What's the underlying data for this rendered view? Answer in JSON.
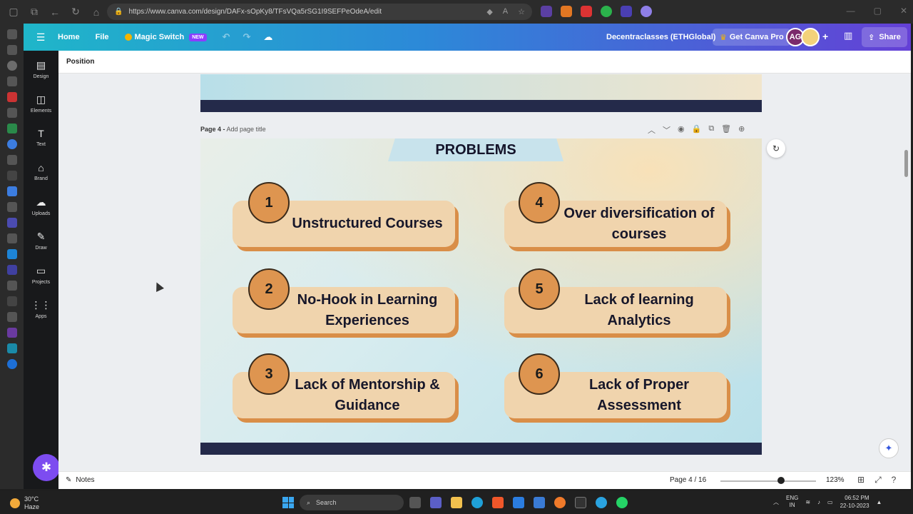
{
  "browser": {
    "url": "https://www.canva.com/design/DAFx-sOpKy8/TFsVQa5rSG1I9SEFPeOdeA/edit"
  },
  "canva": {
    "menu": {
      "home": "Home",
      "file": "File",
      "magic_switch": "Magic Switch",
      "new_badge": "NEW"
    },
    "doc_title": "Decentraclasses (ETHGlobal)",
    "get_pro": "Get Canva Pro",
    "avatar_initials": "AG",
    "share": "Share"
  },
  "rail": [
    {
      "label": "Design",
      "icon": "▤"
    },
    {
      "label": "Elements",
      "icon": "◫"
    },
    {
      "label": "Text",
      "icon": "T"
    },
    {
      "label": "Brand",
      "icon": "⌂"
    },
    {
      "label": "Uploads",
      "icon": "☁"
    },
    {
      "label": "Draw",
      "icon": "✎"
    },
    {
      "label": "Projects",
      "icon": "▭"
    },
    {
      "label": "Apps",
      "icon": "⋮⋮"
    }
  ],
  "toolbar": {
    "position": "Position"
  },
  "page": {
    "label": "Page 4 -",
    "title_placeholder": "Add page title"
  },
  "slide": {
    "title": "PROBLEMS",
    "items": [
      {
        "num": "1",
        "text": "Unstructured Courses"
      },
      {
        "num": "2",
        "text": "No-Hook in Learning Experiences"
      },
      {
        "num": "3",
        "text": "Lack of Mentorship & Guidance"
      },
      {
        "num": "4",
        "text": "Over diversification of courses"
      },
      {
        "num": "5",
        "text": "Lack of learning Analytics"
      },
      {
        "num": "6",
        "text": "Lack of Proper Assessment"
      }
    ]
  },
  "footer": {
    "notes": "Notes",
    "page_indicator": "Page 4 / 16",
    "zoom": "123%"
  },
  "taskbar": {
    "temp": "30°C",
    "weather": "Haze",
    "search": "Search",
    "lang1": "ENG",
    "lang2": "IN",
    "time": "06:52 PM",
    "date": "22-10-2023"
  },
  "colors": {
    "accent": "#8b3dff",
    "card_face": "#f0d4ad",
    "card_shadow": "#d98e48",
    "badge": "#de9550",
    "band": "#242a4a"
  }
}
